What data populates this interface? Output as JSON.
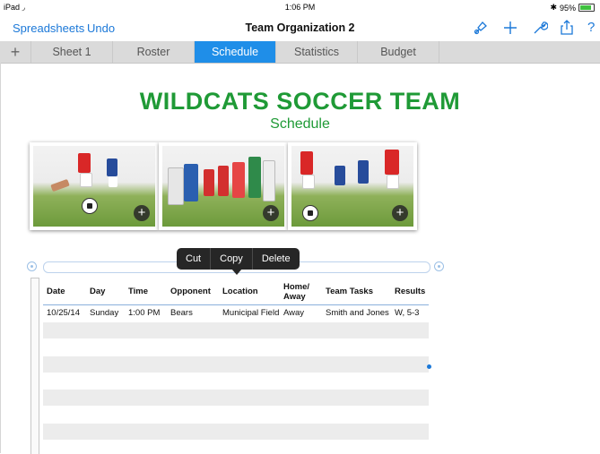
{
  "status": {
    "device": "iPad",
    "time": "1:06 PM",
    "battery": "95%"
  },
  "nav": {
    "back_label": "Spreadsheets",
    "undo_label": "Undo",
    "title": "Team Organization 2"
  },
  "tabs": [
    {
      "label": "Sheet 1"
    },
    {
      "label": "Roster"
    },
    {
      "label": "Schedule"
    },
    {
      "label": "Statistics"
    },
    {
      "label": "Budget"
    }
  ],
  "active_tab": "Schedule",
  "sheet": {
    "title": "WILDCATS SOCCER TEAM",
    "subtitle": "Schedule"
  },
  "edit_menu": {
    "cut": "Cut",
    "copy": "Copy",
    "delete": "Delete"
  },
  "table": {
    "headers": [
      "Date",
      "Day",
      "Time",
      "Opponent",
      "Location",
      "Home/ Away",
      "Team Tasks",
      "Results"
    ],
    "rows": [
      [
        "10/25/14",
        "Sunday",
        "1:00 PM",
        "Bears",
        "Municipal Field",
        "Away",
        "Smith and Jones",
        "W, 5-3"
      ]
    ]
  },
  "colors": {
    "accent": "#1b78d8",
    "active_tab": "#1f8ee8",
    "title_green": "#1f9a36"
  },
  "icons": [
    "wifi-icon",
    "bluetooth-icon",
    "battery-icon",
    "format-brush-icon",
    "add-icon",
    "wrench-icon",
    "share-icon",
    "help-icon",
    "add-tab-icon",
    "add-photo-icon"
  ]
}
